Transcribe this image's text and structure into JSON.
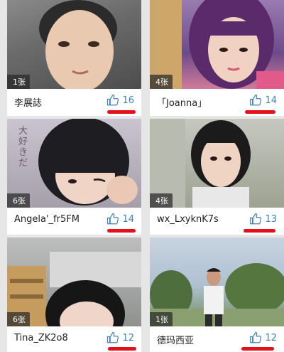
{
  "accent_color": "#3f84c2",
  "annotation_color": "#e4101a",
  "cards": [
    {
      "name": "李展誌",
      "photo_count": "1张",
      "likes": "16",
      "icon": "thumbs-up-icon"
    },
    {
      "name": "「Joanna」",
      "photo_count": "4张",
      "likes": "14",
      "icon": "thumbs-up-icon"
    },
    {
      "name": "Angela'_fr5FM",
      "photo_count": "6张",
      "likes": "14",
      "icon": "thumbs-up-icon",
      "photo_text": "大好きだ"
    },
    {
      "name": "wx_LxyknK7s",
      "photo_count": "4张",
      "likes": "13",
      "icon": "thumbs-up-icon"
    },
    {
      "name": "Tina_ZK2o8",
      "photo_count": "6张",
      "likes": "12",
      "icon": "thumbs-up-icon"
    },
    {
      "name": "德玛西亚",
      "photo_count": "1张",
      "likes": "12",
      "icon": "thumbs-up-icon"
    }
  ]
}
